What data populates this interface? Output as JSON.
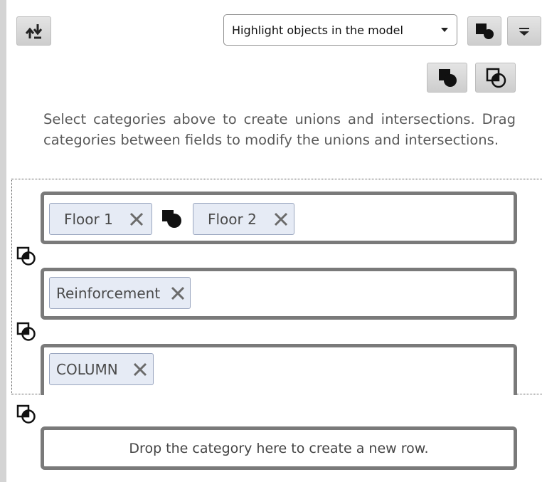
{
  "toolbar": {
    "sort_icon": "sort-up-down-icon",
    "highlight_select": {
      "value": "Highlight objects in the model"
    },
    "union_mode_icon": "square-circle-icon",
    "menu_icon": "menu-lines-icon"
  },
  "operators": {
    "union_icon": "union-icon",
    "intersection_icon": "intersection-icon"
  },
  "instructions": "Select categories above to create unions and intersections. Drag categories between fields to modify the unions and intersections.",
  "rows": [
    {
      "chips": [
        "Floor 1",
        "Floor 2"
      ],
      "operator": "union"
    },
    {
      "chips": [
        "Reinforcement"
      ]
    },
    {
      "chips": [
        "COLUMN"
      ]
    }
  ],
  "drop_zone": {
    "label": "Drop the category here to create a new row."
  },
  "colors": {
    "chip_bg": "#e6ebf5",
    "chip_border": "#9aa6bf",
    "row_border": "#7a7a7a"
  }
}
